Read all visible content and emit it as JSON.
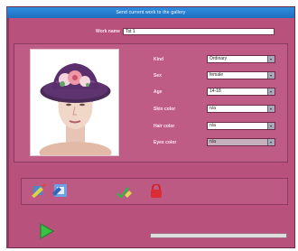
{
  "title": "Send current work to the gallery",
  "work_name": {
    "label": "Work name",
    "value": "Tst 1"
  },
  "fields": [
    {
      "label": "Kind",
      "value": "Ordinary"
    },
    {
      "label": "Sex",
      "value": "female"
    },
    {
      "label": "Age",
      "value": "14-18"
    },
    {
      "label": "Skin color",
      "value": "n/a"
    },
    {
      "label": "Hair color",
      "value": "n/a"
    },
    {
      "label": "Eyes color",
      "value": "n/a"
    }
  ],
  "icons": [
    "edit-photo-icon",
    "gallery-send-icon",
    "edit-check-icon",
    "lock-icon",
    "play-icon"
  ],
  "progress": 0
}
